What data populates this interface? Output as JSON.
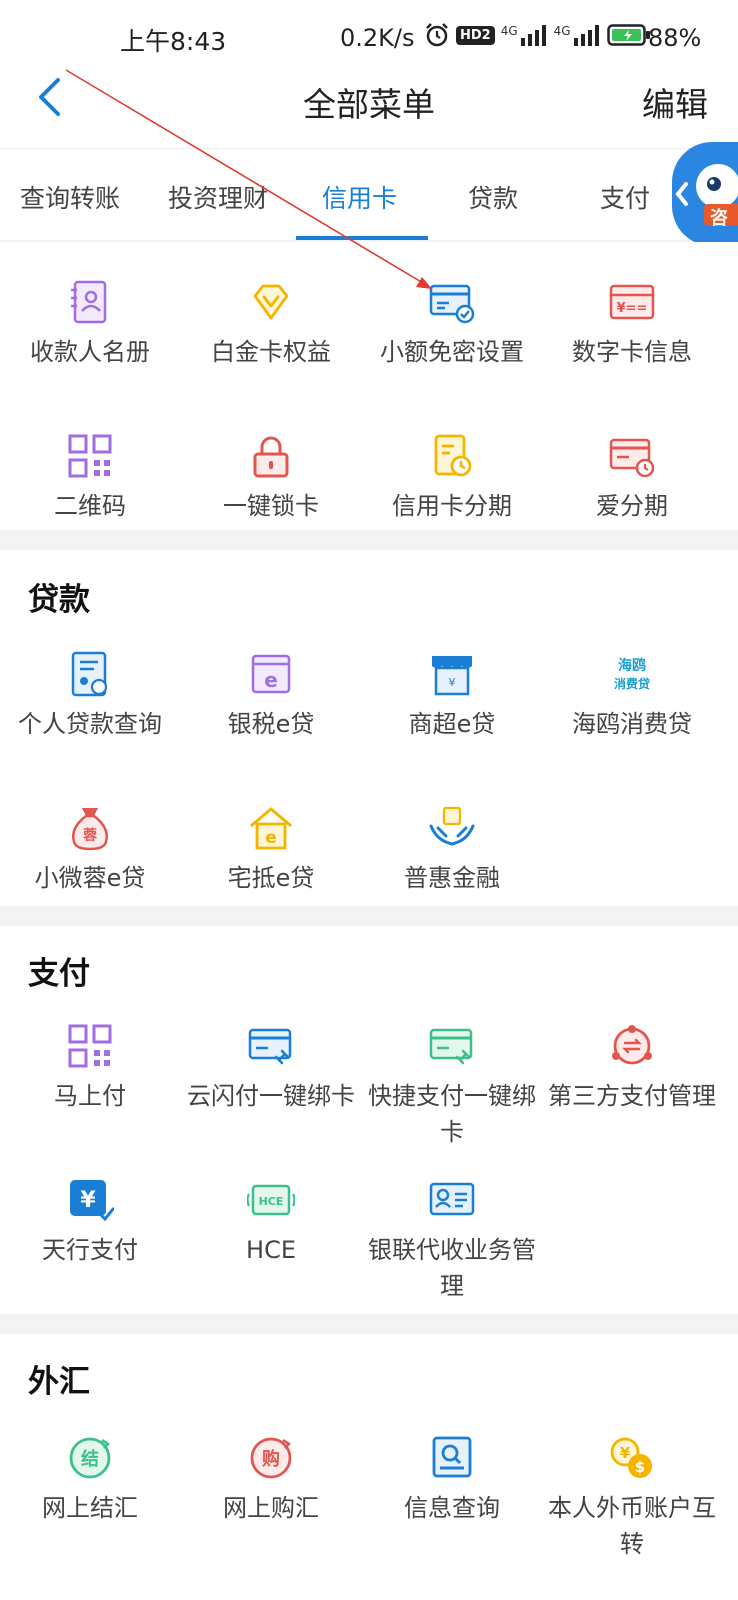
{
  "status_bar": {
    "time": "上午8:43",
    "net_speed": "0.2K/s",
    "hd": "HD2",
    "network_1": "4G",
    "network_2": "4G",
    "battery": "88%"
  },
  "header": {
    "title": "全部菜单",
    "edit_label": "编辑"
  },
  "tabs": [
    {
      "label": "查询转账"
    },
    {
      "label": "投资理财"
    },
    {
      "label": "信用卡"
    },
    {
      "label": "贷款"
    },
    {
      "label": "支付"
    }
  ],
  "mascot_text": "咨",
  "credit_card": {
    "items": [
      {
        "label": "收款人名册",
        "icon": "contact-book-icon"
      },
      {
        "label": "白金卡权益",
        "icon": "diamond-icon"
      },
      {
        "label": "小额免密设置",
        "icon": "card-check-icon"
      },
      {
        "label": "数字卡信息",
        "icon": "digital-card-icon"
      },
      {
        "label": "二维码",
        "icon": "qr-code-icon"
      },
      {
        "label": "一键锁卡",
        "icon": "lock-icon"
      },
      {
        "label": "信用卡分期",
        "icon": "installment-icon"
      },
      {
        "label": "爱分期",
        "icon": "card-clock-icon"
      }
    ]
  },
  "loans": {
    "title": "贷款",
    "items": [
      {
        "label": "个人贷款查询",
        "icon": "loan-doc-icon"
      },
      {
        "label": "银税e贷",
        "icon": "e-box-icon"
      },
      {
        "label": "商超e贷",
        "icon": "store-icon"
      },
      {
        "label": "海鸥消费贷",
        "icon": "haiou-logo-icon",
        "icon_text": "海鸥\n消费贷"
      },
      {
        "label": "小微蓉e贷",
        "icon": "money-bag-icon",
        "icon_text": "蓉"
      },
      {
        "label": "宅抵e贷",
        "icon": "house-icon"
      },
      {
        "label": "普惠金融",
        "icon": "hands-icon"
      }
    ]
  },
  "payment": {
    "title": "支付",
    "items": [
      {
        "label": "马上付",
        "icon": "qr-code-icon"
      },
      {
        "label": "云闪付一键绑卡",
        "icon": "card-link-icon"
      },
      {
        "label": "快捷支付一键绑卡",
        "icon": "card-link-green-icon"
      },
      {
        "label": "第三方支付管理",
        "icon": "transfer-circle-icon"
      },
      {
        "label": "天行支付",
        "icon": "yuan-check-icon"
      },
      {
        "label": "HCE",
        "icon": "hce-icon",
        "icon_text": "HCE"
      },
      {
        "label": "银联代收业务管理",
        "icon": "id-card-icon"
      }
    ]
  },
  "forex": {
    "title": "外汇",
    "items": [
      {
        "label": "网上结汇",
        "icon": "settle-icon",
        "icon_text": "结"
      },
      {
        "label": "网上购汇",
        "icon": "purchase-icon",
        "icon_text": "购"
      },
      {
        "label": "信息查询",
        "icon": "search-doc-icon"
      },
      {
        "label": "本人外币账户互转",
        "icon": "currency-icon"
      }
    ]
  },
  "colors": {
    "accent": "#1a7fd4",
    "purple": "#a06ee0",
    "yellow": "#f4b400",
    "red": "#e2564f",
    "green": "#3cc08a"
  }
}
